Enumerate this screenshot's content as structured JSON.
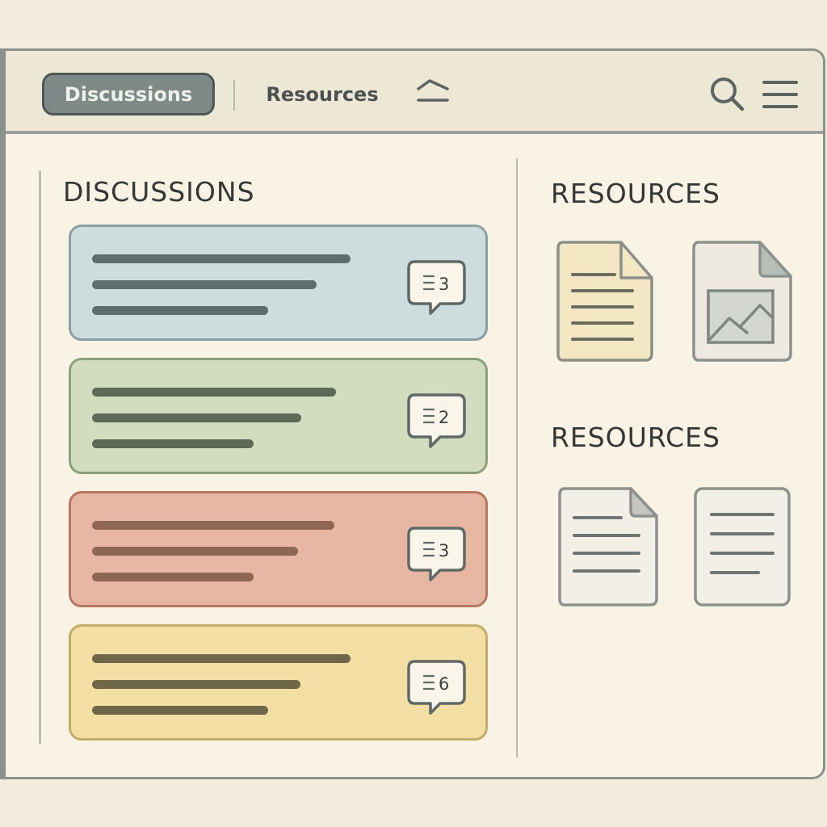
{
  "nav": {
    "tabs": [
      {
        "label": "Discussions",
        "active": true
      },
      {
        "label": "Resources",
        "active": false
      }
    ],
    "icons": [
      "collapse-icon",
      "search-icon",
      "menu-icon"
    ]
  },
  "discussions": {
    "title": "DISCUSSIONS",
    "threads": [
      {
        "color": "#cdddde",
        "reply_count": "3"
      },
      {
        "color": "#d2dcbf",
        "reply_count": "2"
      },
      {
        "color": "#e8b7a3",
        "reply_count": "3"
      },
      {
        "color": "#f3dfa4",
        "reply_count": "6"
      }
    ]
  },
  "resources": {
    "sections": [
      {
        "title": "RESOURCES",
        "items": [
          "document-icon",
          "image-file-icon"
        ]
      },
      {
        "title": "RESOURCES",
        "items": [
          "document-icon",
          "document-icon"
        ]
      }
    ]
  },
  "colors": {
    "background": "#f9f3e6",
    "toolbar": "#ede7d6",
    "active_tab": "#7e8a87",
    "border": "#8b928d"
  }
}
